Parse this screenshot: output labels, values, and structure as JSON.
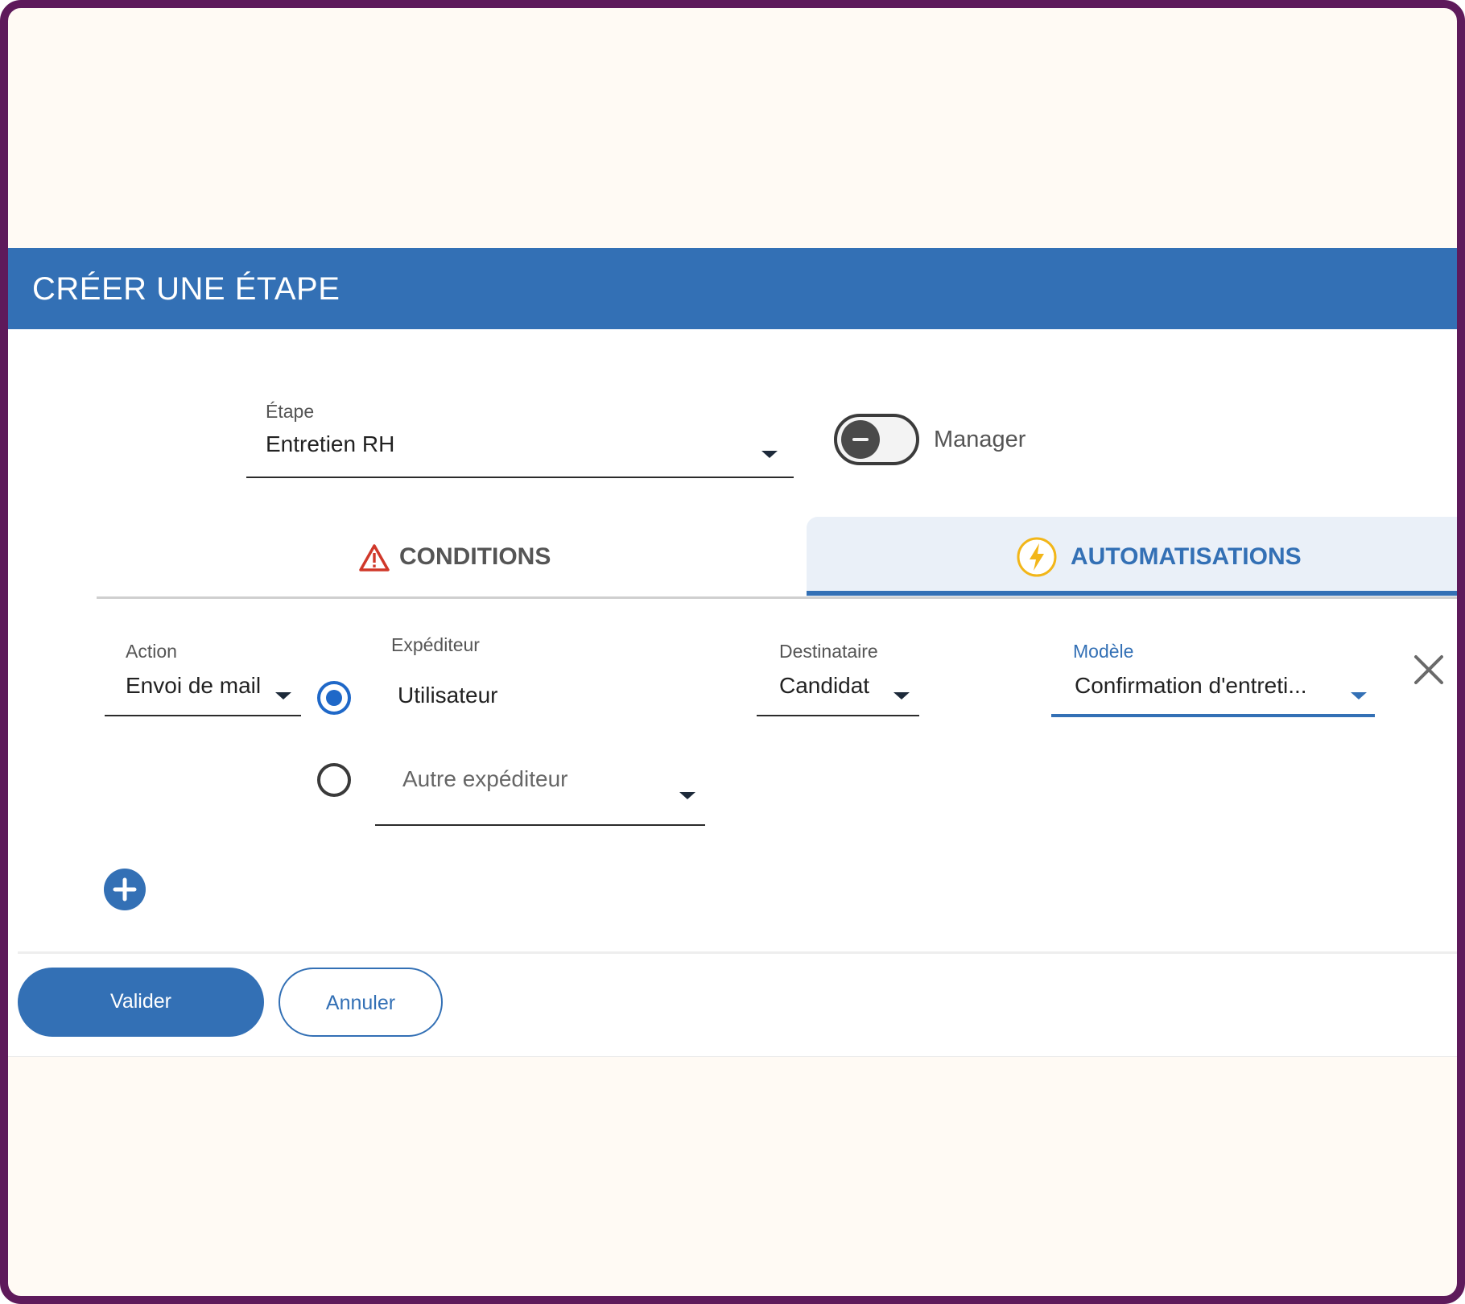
{
  "dialog": {
    "title": "CRÉER UNE ÉTAPE"
  },
  "etape": {
    "label": "Étape",
    "value": "Entretien RH"
  },
  "manager_toggle": {
    "label": "Manager",
    "state": "off"
  },
  "tabs": [
    {
      "label": "CONDITIONS",
      "icon": "warning-triangle-icon",
      "active": false
    },
    {
      "label": "AUTOMATISATIONS",
      "icon": "lightning-bolt-icon",
      "active": true
    }
  ],
  "automation": {
    "action": {
      "label": "Action",
      "value": "Envoi de mail"
    },
    "expediteur": {
      "label": "Expéditeur",
      "options": [
        {
          "label": "Utilisateur",
          "selected": true
        },
        {
          "placeholder": "Autre expéditeur",
          "selected": false
        }
      ]
    },
    "destinataire": {
      "label": "Destinataire",
      "value": "Candidat"
    },
    "modele": {
      "label": "Modèle",
      "value": "Confirmation d'entreti..."
    }
  },
  "footer": {
    "validate_label": "Valider",
    "cancel_label": "Annuler"
  },
  "colors": {
    "primary": "#3370b5",
    "frame": "#5e1a5b",
    "warning": "#d0382a",
    "bolt": "#f2b619",
    "tab_active_bg": "#eaf0f8"
  }
}
